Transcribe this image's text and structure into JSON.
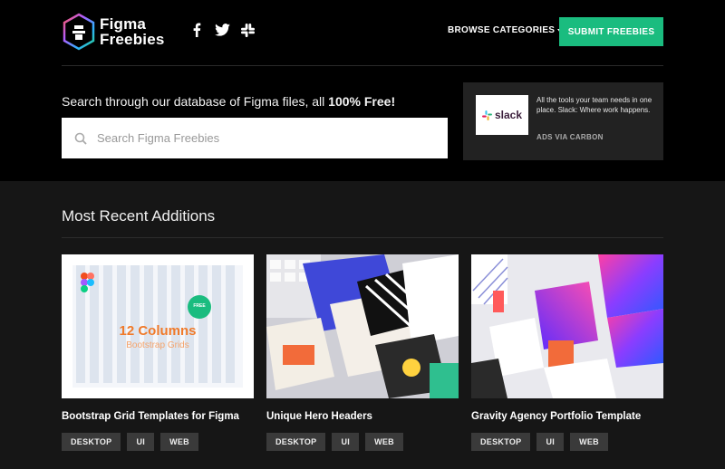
{
  "header": {
    "logo_line1": "Figma",
    "logo_line2": "Freebies",
    "social_icons": [
      "facebook-icon",
      "twitter-icon",
      "slack-icon"
    ],
    "browse_label": "BROWSE CATEGORIES",
    "submit_label": "SUBMIT FREEBIES"
  },
  "hero": {
    "tagline_prefix": "Search through our database of Figma files, all ",
    "tagline_bold": "100% Free!",
    "search_placeholder": "Search Figma Freebies"
  },
  "ad": {
    "logo_text": "slack",
    "text": "All the tools your team needs in one place. Slack: Where work happens.",
    "via": "ADS VIA CARBON"
  },
  "section": {
    "title": "Most Recent Additions"
  },
  "cards": [
    {
      "title": "Bootstrap Grid Templates for Figma",
      "thumb_heading": "12 Columns",
      "thumb_sub": "Bootstrap Grids",
      "thumb_badge": "FREE",
      "tags": [
        "DESKTOP",
        "UI",
        "WEB"
      ]
    },
    {
      "title": "Unique Hero Headers",
      "tags": [
        "DESKTOP",
        "UI",
        "WEB"
      ]
    },
    {
      "title": "Gravity Agency Portfolio Template",
      "tags": [
        "DESKTOP",
        "UI",
        "WEB"
      ]
    }
  ],
  "colors": {
    "accent": "#1abc7f",
    "background": "#000000",
    "section_bg": "#161616",
    "tag_bg": "#3a3a3a",
    "card1_heading": "#f07a2a"
  }
}
